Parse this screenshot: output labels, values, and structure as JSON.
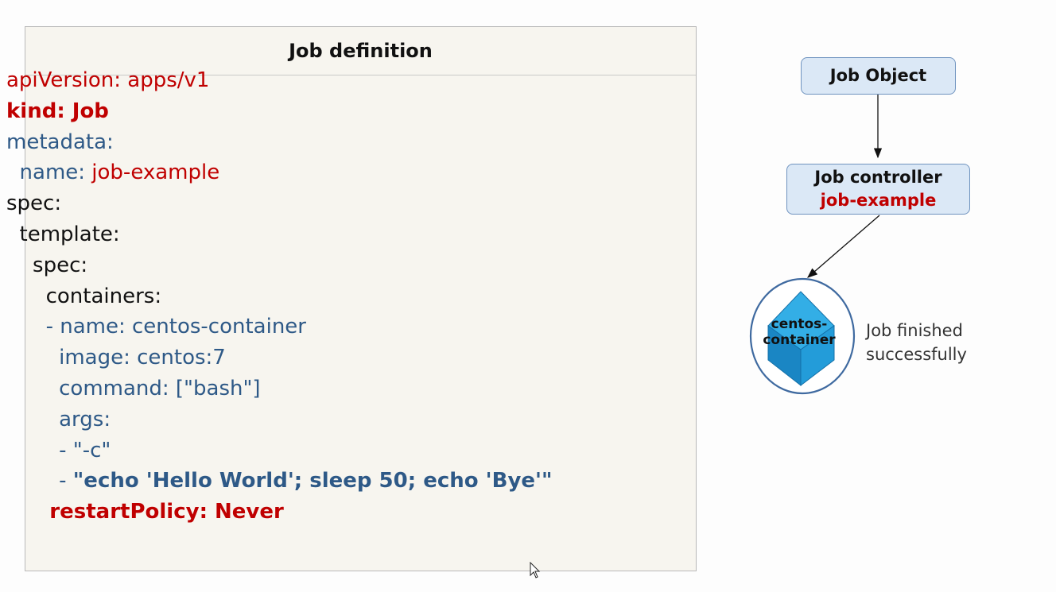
{
  "definition": {
    "title": "Job definition",
    "lines": [
      {
        "parts": [
          {
            "text": "apiVersion: apps/v1",
            "style": "red"
          }
        ]
      },
      {
        "parts": [
          {
            "text": "kind: Job",
            "style": "red bold"
          }
        ]
      },
      {
        "parts": [
          {
            "text": "metadata:",
            "style": "blue"
          }
        ]
      },
      {
        "parts": [
          {
            "text": "  name: ",
            "style": "blue"
          },
          {
            "text": "job-example",
            "style": "red"
          }
        ]
      },
      {
        "parts": [
          {
            "text": "spec:",
            "style": "black"
          }
        ]
      },
      {
        "parts": [
          {
            "text": "  template:",
            "style": "black"
          }
        ]
      },
      {
        "parts": [
          {
            "text": "    spec:",
            "style": "black"
          }
        ]
      },
      {
        "parts": [
          {
            "text": "      containers:",
            "style": "black"
          }
        ]
      },
      {
        "parts": [
          {
            "text": "      - name: centos-container",
            "style": "blue"
          }
        ]
      },
      {
        "parts": [
          {
            "text": "        image: centos:7",
            "style": "blue"
          }
        ]
      },
      {
        "parts": [
          {
            "text": "        command: [\"bash\"]",
            "style": "blue"
          }
        ]
      },
      {
        "parts": [
          {
            "text": "        args:",
            "style": "blue"
          }
        ]
      },
      {
        "parts": [
          {
            "text": "        - \"-c\"",
            "style": "blue"
          }
        ]
      },
      {
        "parts": [
          {
            "text": "        - ",
            "style": "blue"
          },
          {
            "text": "\"echo 'Hello World'; sleep 50; echo 'Bye'\"",
            "style": "blue bold"
          }
        ]
      },
      {
        "parts": [
          {
            "text": "      restartPolicy: Never",
            "style": "red bold"
          }
        ]
      }
    ]
  },
  "diagram": {
    "job_object": "Job Object",
    "job_controller": {
      "title": "Job controller",
      "name": "job-example"
    },
    "pod": {
      "label_line1": "centos-",
      "label_line2": "container",
      "icon": "cube-icon"
    },
    "status": {
      "line1": "Job finished",
      "line2": "successfully"
    }
  },
  "colors": {
    "red": "#c00000",
    "blue": "#2e5987",
    "node_fill": "#dbe8f6",
    "node_border": "#6f93bf",
    "cube": "#1e9fd8",
    "panel_bg": "#f7f5ef"
  }
}
